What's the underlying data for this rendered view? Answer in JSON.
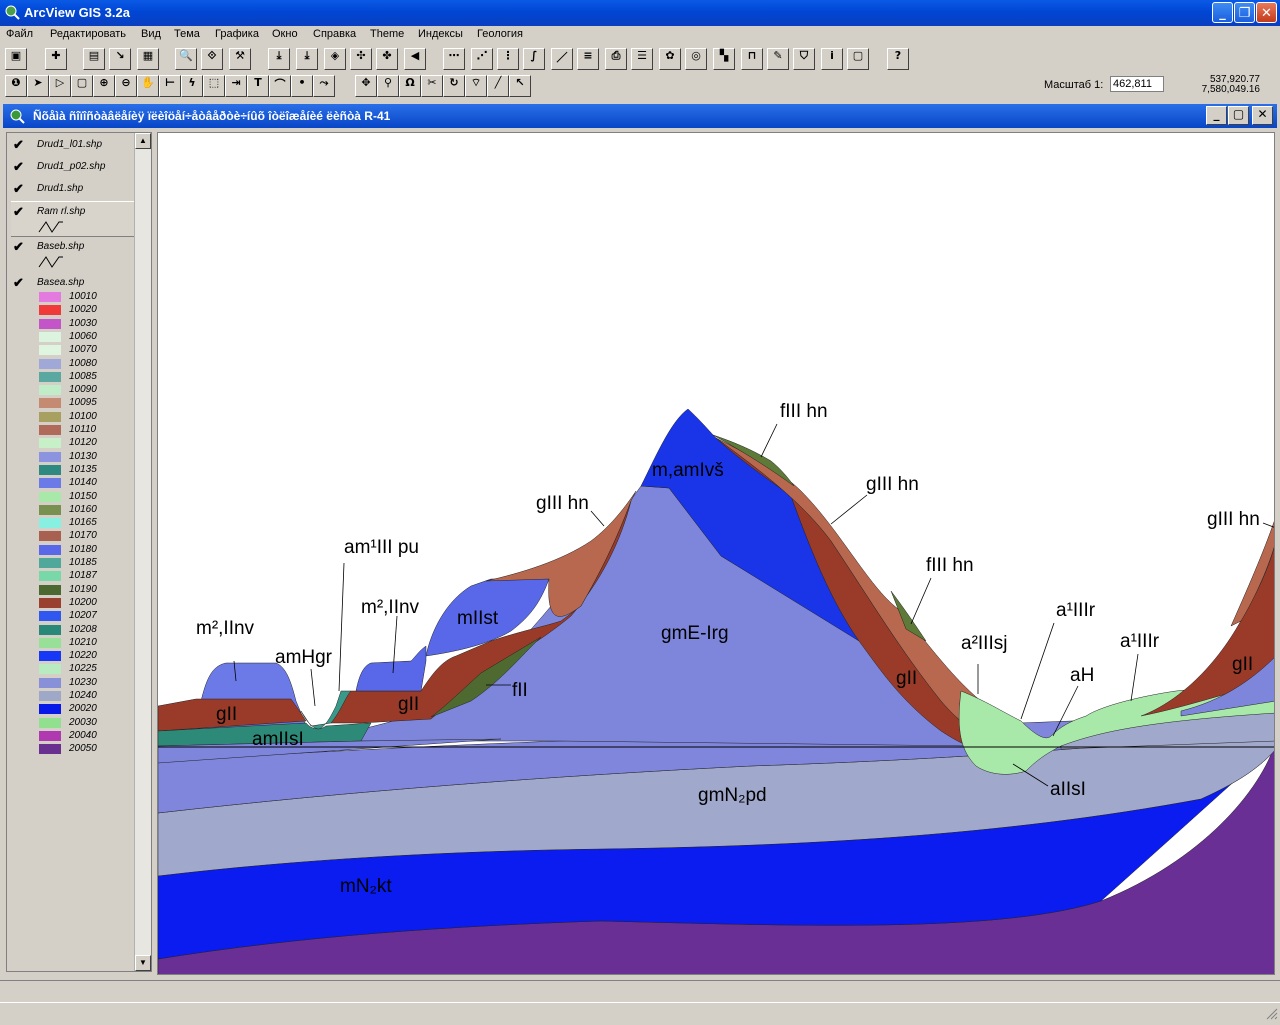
{
  "app": {
    "title": "ArcView GIS 3.2a"
  },
  "menu": [
    "Файл",
    "Редактировать",
    "Вид",
    "Тема",
    "Графика",
    "Окно",
    "Справка",
    "Theme",
    "Индексы",
    "Геология"
  ],
  "scale": {
    "label": "Масштаб  1:",
    "value": "462,811"
  },
  "coords": {
    "x": "537,920.77",
    "y": "7,580,049.16"
  },
  "view_window": {
    "title": "Ñõåìà ñîïîñòàâëåíèÿ ïëèîöåí÷åòâåðòè÷íûõ îòëîæåíèé ëèñòà R-41"
  },
  "layers": [
    {
      "name": "Drud1_l01.shp",
      "checked": true
    },
    {
      "name": "Drud1_p02.shp",
      "checked": true
    },
    {
      "name": "Drud1.shp",
      "checked": true
    },
    {
      "name": "Ram rl.shp",
      "checked": true
    },
    {
      "name": "Baseb.shp",
      "checked": true
    },
    {
      "name": "Basea.shp",
      "checked": true
    }
  ],
  "legend": [
    {
      "code": "10010",
      "color": "#e27ae0"
    },
    {
      "code": "10020",
      "color": "#f03a3a"
    },
    {
      "code": "10030",
      "color": "#c455c8"
    },
    {
      "code": "10060",
      "color": "#dcf3e0"
    },
    {
      "code": "10070",
      "color": "#dff5e0"
    },
    {
      "code": "10080",
      "color": "#a0a8d8"
    },
    {
      "code": "10085",
      "color": "#5aa8a0"
    },
    {
      "code": "10090",
      "color": "#c0ecc8"
    },
    {
      "code": "10095",
      "color": "#c48a72"
    },
    {
      "code": "10100",
      "color": "#a8a060"
    },
    {
      "code": "10110",
      "color": "#b06a5a"
    },
    {
      "code": "10120",
      "color": "#c8f0c8"
    },
    {
      "code": "10130",
      "color": "#8c94e0"
    },
    {
      "code": "10135",
      "color": "#2e8a80"
    },
    {
      "code": "10140",
      "color": "#6c7ae8"
    },
    {
      "code": "10150",
      "color": "#a8e8a8"
    },
    {
      "code": "10160",
      "color": "#789050"
    },
    {
      "code": "10165",
      "color": "#88f0e0"
    },
    {
      "code": "10170",
      "color": "#a86050"
    },
    {
      "code": "10180",
      "color": "#5868e8"
    },
    {
      "code": "10185",
      "color": "#50a89a"
    },
    {
      "code": "10187",
      "color": "#78d8a8"
    },
    {
      "code": "10190",
      "color": "#4a6830"
    },
    {
      "code": "10200",
      "color": "#9a4030"
    },
    {
      "code": "10207",
      "color": "#3058f0"
    },
    {
      "code": "10208",
      "color": "#2a8878"
    },
    {
      "code": "10210",
      "color": "#98e098"
    },
    {
      "code": "10220",
      "color": "#1838f8"
    },
    {
      "code": "10225",
      "color": "#b8ecc0"
    },
    {
      "code": "10230",
      "color": "#8890d8"
    },
    {
      "code": "10240",
      "color": "#a0a8c8"
    },
    {
      "code": "20020",
      "color": "#0818e8"
    },
    {
      "code": "20030",
      "color": "#90e090"
    },
    {
      "code": "20040",
      "color": "#b038b0"
    },
    {
      "code": "20050",
      "color": "#6a3090"
    }
  ],
  "map_labels": {
    "m2llnv_left": "m²,IInv",
    "gll_left": "gII",
    "amhgr": "amHgr",
    "am1lllpu": "am¹III pu",
    "m2llnv_mid": "m²,IInv",
    "mllst": "mIIst",
    "gll_mid": "gII",
    "amllsl": "amIIsI",
    "fll": "fII",
    "glllhn_left": "gIII hn",
    "mamlvs": "m,amIvš",
    "gme_lrg": "gmE-Irg",
    "flllhn_top": "fIII hn",
    "glllhn_mid": "gIII hn",
    "flllhn_right": "fIII hn",
    "gll_right": "gII",
    "a2lllsj": "a²IIIsj",
    "a1lllr_mid": "a¹IIIr",
    "ah": "aH",
    "a1lllr_right": "a¹IIIr",
    "glllhn_far": "gIII hn",
    "gll_far": "gII",
    "allsl": "aIIsI",
    "gmn2pd": "gmN₂pd",
    "mn2kt": "mN₂kt"
  }
}
